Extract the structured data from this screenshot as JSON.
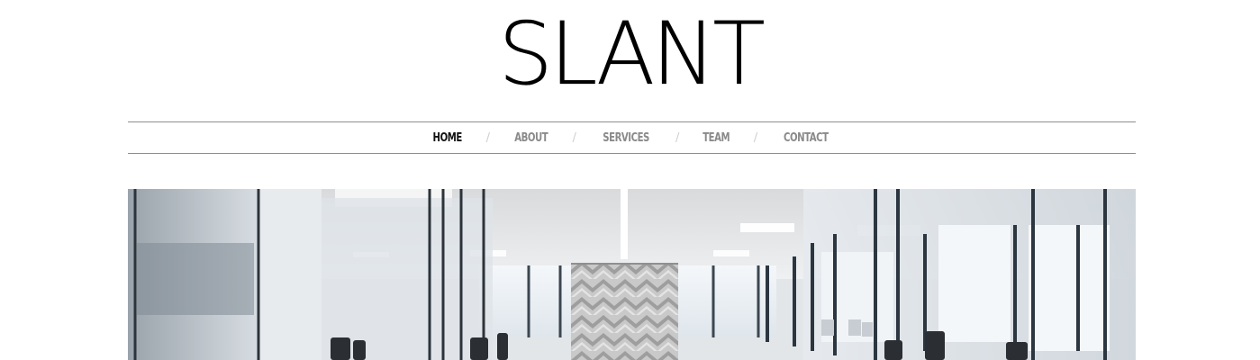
{
  "site": {
    "logo_text": "SLANT"
  },
  "nav": {
    "items": [
      {
        "label": "HOME",
        "active": true
      },
      {
        "label": "ABOUT",
        "active": false
      },
      {
        "label": "SERVICES",
        "active": false
      },
      {
        "label": "TEAM",
        "active": false
      },
      {
        "label": "CONTACT",
        "active": false
      }
    ],
    "separator": "/"
  },
  "hero": {
    "image_subject": "office-interior-photo"
  },
  "colors": {
    "text_primary": "#111111",
    "nav_inactive": "#8a8a8a",
    "rule": "#8e8e8e",
    "background": "#ffffff"
  }
}
